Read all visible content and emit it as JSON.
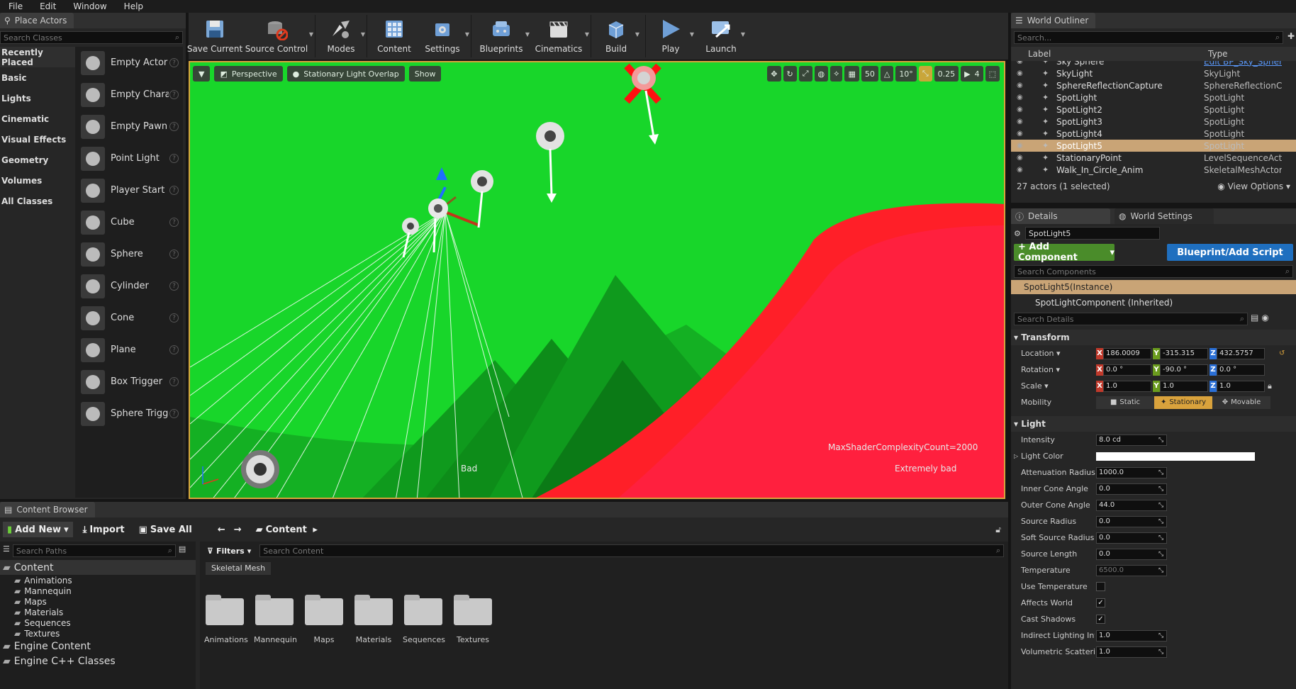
{
  "menu": [
    "File",
    "Edit",
    "Window",
    "Help"
  ],
  "place_actors": {
    "tab": "Place Actors",
    "search_placeholder": "Search Classes",
    "categories": [
      "Recently Placed",
      "Basic",
      "Lights",
      "Cinematic",
      "Visual Effects",
      "Geometry",
      "Volumes",
      "All Classes"
    ],
    "items": [
      "Empty Actor",
      "Empty Charac",
      "Empty Pawn",
      "Point Light",
      "Player Start",
      "Cube",
      "Sphere",
      "Cylinder",
      "Cone",
      "Plane",
      "Box Trigger",
      "Sphere Trigge"
    ]
  },
  "toolbar": [
    "Save Current",
    "Source Control",
    "Modes",
    "Content",
    "Settings",
    "Blueprints",
    "Cinematics",
    "Build",
    "Play",
    "Launch"
  ],
  "viewport": {
    "perspective": "Perspective",
    "view_mode": "Stationary Light Overlap",
    "show": "Show",
    "grid": "50",
    "rot": "10°",
    "scale": "0.25",
    "cam_speed": "4",
    "max_count": "MaxShaderComplexityCount=2000",
    "label_bad": "Bad",
    "label_extreme": "Extremely bad"
  },
  "outliner": {
    "tab": "World Outliner",
    "search_placeholder": "Search...",
    "col_label": "Label",
    "col_type": "Type",
    "rows": [
      {
        "name": "Sky Sphere",
        "type": "Edit BP_Sky_Spher"
      },
      {
        "name": "SkyLight",
        "type": "SkyLight"
      },
      {
        "name": "SphereReflectionCapture",
        "type": "SphereReflectionCap"
      },
      {
        "name": "SpotLight",
        "type": "SpotLight"
      },
      {
        "name": "SpotLight2",
        "type": "SpotLight"
      },
      {
        "name": "SpotLight3",
        "type": "SpotLight"
      },
      {
        "name": "SpotLight4",
        "type": "SpotLight"
      },
      {
        "name": "SpotLight5",
        "type": "SpotLight"
      },
      {
        "name": "StationaryPoint",
        "type": "LevelSequenceActor"
      },
      {
        "name": "Walk_In_Circle_Anim",
        "type": "SkeletalMeshActor"
      }
    ],
    "status": "27 actors (1 selected)",
    "view_options": "View Options"
  },
  "details": {
    "tab": "Details",
    "tab2": "World Settings",
    "name": "SpotLight5",
    "add_component": "+ Add Component",
    "blueprint": "Blueprint/Add Script",
    "search_components": "Search Components",
    "instance": "SpotLight5(Instance)",
    "component": "SpotLightComponent (Inherited)",
    "search_details": "Search Details",
    "transform": "Transform",
    "location": {
      "label": "Location",
      "x": "186.0009",
      "y": "-315.315",
      "z": "432.5757"
    },
    "rotation": {
      "label": "Rotation",
      "x": "0.0 °",
      "y": "-90.0 °",
      "z": "0.0 °"
    },
    "scale": {
      "label": "Scale",
      "x": "1.0",
      "y": "1.0",
      "z": "1.0"
    },
    "mobility": {
      "label": "Mobility",
      "opts": [
        "Static",
        "Stationary",
        "Movable"
      ]
    },
    "light": "Light",
    "props": [
      {
        "label": "Intensity",
        "value": "8.0 cd"
      },
      {
        "label": "Light Color",
        "value": ""
      },
      {
        "label": "Attenuation Radius",
        "value": "1000.0"
      },
      {
        "label": "Inner Cone Angle",
        "value": "0.0"
      },
      {
        "label": "Outer Cone Angle",
        "value": "44.0"
      },
      {
        "label": "Source Radius",
        "value": "0.0"
      },
      {
        "label": "Soft Source Radius",
        "value": "0.0"
      },
      {
        "label": "Source Length",
        "value": "0.0"
      },
      {
        "label": "Temperature",
        "value": "6500.0"
      }
    ],
    "checks": [
      {
        "label": "Use Temperature",
        "checked": false
      },
      {
        "label": "Affects World",
        "checked": true
      },
      {
        "label": "Cast Shadows",
        "checked": true
      }
    ],
    "props2": [
      {
        "label": "Indirect Lighting Inter",
        "value": "1.0"
      },
      {
        "label": "Volumetric Scatterin",
        "value": "1.0"
      }
    ]
  },
  "content_browser": {
    "tab": "Content Browser",
    "add_new": "Add New",
    "import": "Import",
    "save_all": "Save All",
    "crumb": "Content",
    "search_paths": "Search Paths",
    "filters": "Filters",
    "search_content": "Search Content",
    "filter_chip": "Skeletal Mesh",
    "tree": [
      {
        "label": "Content",
        "lvl": 0
      },
      {
        "label": "Animations",
        "lvl": 1
      },
      {
        "label": "Mannequin",
        "lvl": 1
      },
      {
        "label": "Maps",
        "lvl": 1
      },
      {
        "label": "Materials",
        "lvl": 1
      },
      {
        "label": "Sequences",
        "lvl": 1
      },
      {
        "label": "Textures",
        "lvl": 1
      },
      {
        "label": "Engine Content",
        "lvl": 0
      },
      {
        "label": "Engine C++ Classes",
        "lvl": 0
      }
    ],
    "folders": [
      "Animations",
      "Mannequin",
      "Maps",
      "Materials",
      "Sequences",
      "Textures"
    ]
  }
}
